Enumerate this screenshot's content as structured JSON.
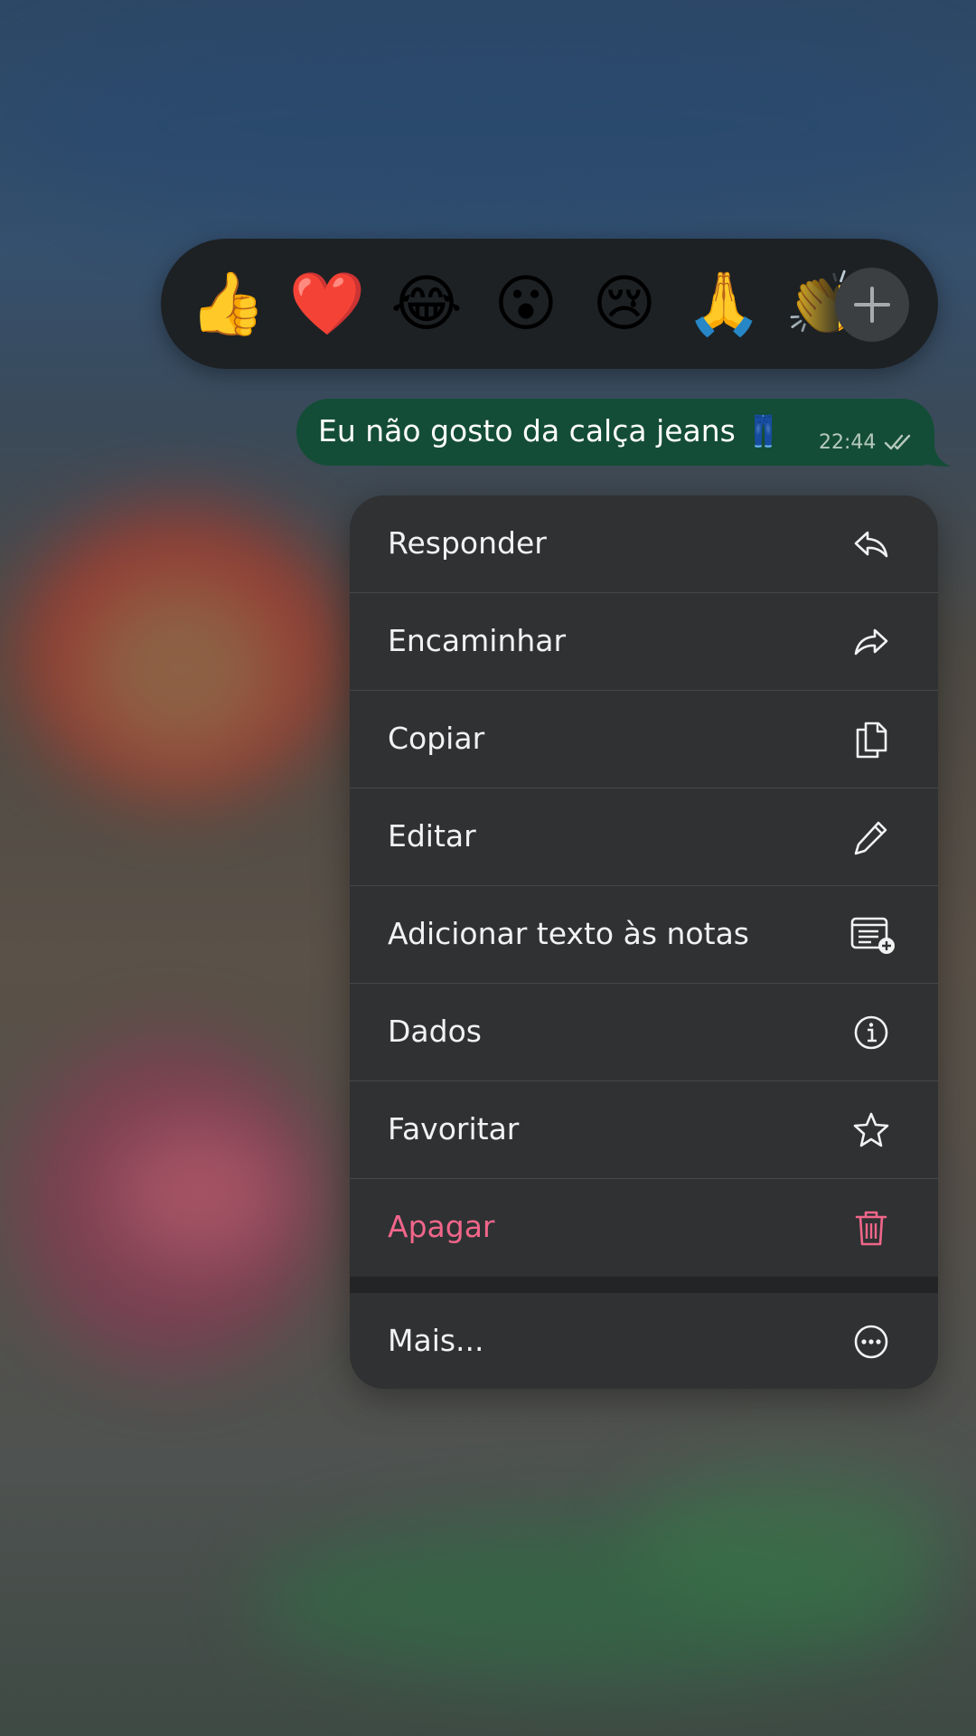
{
  "reactions": {
    "emojis": [
      "👍",
      "❤️",
      "😂",
      "😮",
      "😢",
      "🙏",
      "👏"
    ],
    "add_icon": "plus-icon"
  },
  "message": {
    "text": "Eu não gosto da calça jeans 👖",
    "time": "22:44",
    "status_icon": "double-check-icon",
    "bubble_color": "#144d37"
  },
  "menu": {
    "items": [
      {
        "label": "Responder",
        "icon": "reply-icon"
      },
      {
        "label": "Encaminhar",
        "icon": "forward-icon"
      },
      {
        "label": "Copiar",
        "icon": "copy-icon"
      },
      {
        "label": "Editar",
        "icon": "pencil-icon"
      },
      {
        "label": "Adicionar texto às notas",
        "icon": "add-note-icon"
      },
      {
        "label": "Dados",
        "icon": "info-icon"
      },
      {
        "label": "Favoritar",
        "icon": "star-icon"
      },
      {
        "label": "Apagar",
        "icon": "trash-icon"
      }
    ],
    "more": {
      "label": "Mais...",
      "icon": "more-icon"
    },
    "danger_color": "#f0668a"
  }
}
